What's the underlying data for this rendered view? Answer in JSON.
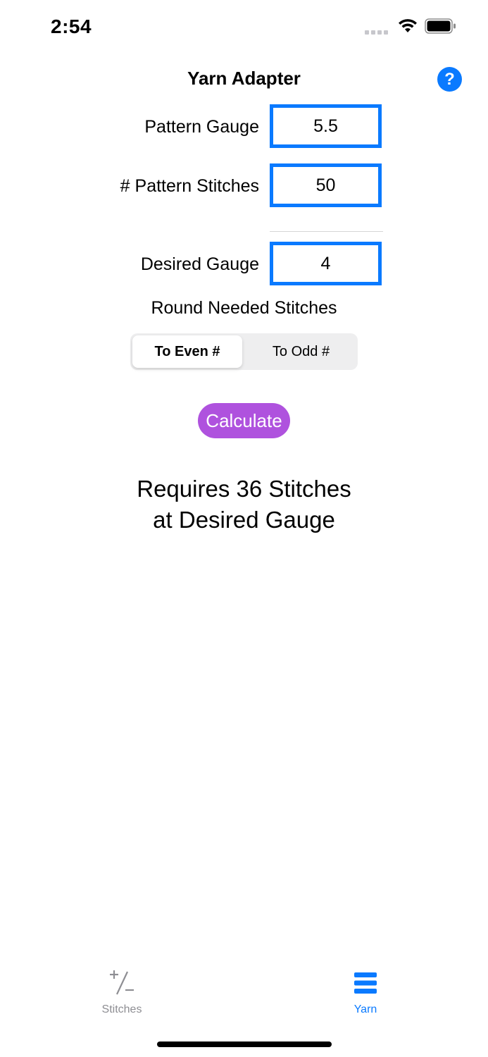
{
  "status_bar": {
    "time": "2:54"
  },
  "header": {
    "title": "Yarn Adapter",
    "help_label": "?"
  },
  "form": {
    "pattern_gauge": {
      "label": "Pattern Gauge",
      "value": "5.5"
    },
    "pattern_stitches": {
      "label": "# Pattern Stitches",
      "value": "50"
    },
    "desired_gauge": {
      "label": "Desired Gauge",
      "value": "4"
    },
    "round_label": "Round Needed Stitches",
    "rounding": {
      "options": [
        "To Even #",
        "To Odd #"
      ],
      "selected": "To Even #"
    },
    "calculate_label": "Calculate"
  },
  "result": {
    "line1": "Requires 36 Stitches",
    "line2": "at Desired Gauge"
  },
  "tab_bar": {
    "items": [
      {
        "label": "Stitches",
        "icon": "plus-minus-icon",
        "active": false
      },
      {
        "label": "Yarn",
        "icon": "three-lines-icon",
        "active": true
      }
    ]
  },
  "colors": {
    "accent": "#0a7aff",
    "button": "#af52de",
    "inactive": "#8e8e93"
  }
}
